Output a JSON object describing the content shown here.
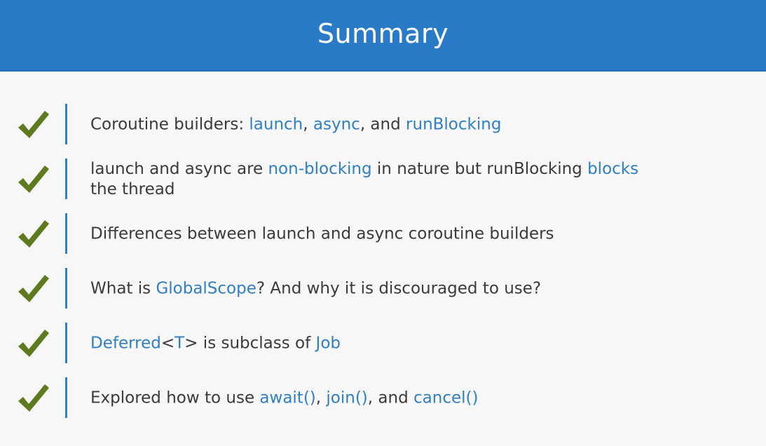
{
  "slide": {
    "title": "Summary"
  },
  "colors": {
    "header_bg": "#2a7bc7",
    "accent": "#2e7fc4",
    "check": "#5e7a1e",
    "text": "#3a3a3a",
    "background": "#f7f7f7"
  },
  "items": [
    {
      "icon": "checkmark-icon",
      "segments": [
        {
          "text": "Coroutine builders: ",
          "hl": false
        },
        {
          "text": "launch",
          "hl": true
        },
        {
          "text": ", ",
          "hl": false
        },
        {
          "text": "async",
          "hl": true
        },
        {
          "text": ", and ",
          "hl": false
        },
        {
          "text": "runBlocking",
          "hl": true
        }
      ]
    },
    {
      "icon": "checkmark-icon",
      "segments": [
        {
          "text": "launch and async are ",
          "hl": false
        },
        {
          "text": "non-blocking",
          "hl": true
        },
        {
          "text": " in nature but runBlocking ",
          "hl": false
        },
        {
          "text": "blocks",
          "hl": true
        },
        {
          "text": "the thread",
          "hl": false,
          "br": true
        }
      ]
    },
    {
      "icon": "checkmark-icon",
      "segments": [
        {
          "text": "Differences between launch and async coroutine builders",
          "hl": false
        }
      ]
    },
    {
      "icon": "checkmark-icon",
      "segments": [
        {
          "text": "What is ",
          "hl": false
        },
        {
          "text": "GlobalScope",
          "hl": true
        },
        {
          "text": "? And why it is discouraged to use?",
          "hl": false
        }
      ]
    },
    {
      "icon": "checkmark-icon",
      "segments": [
        {
          "text": "Deferred",
          "hl": true
        },
        {
          "text": "<",
          "hl": false
        },
        {
          "text": "T",
          "hl": true
        },
        {
          "text": "> is subclass of ",
          "hl": false
        },
        {
          "text": "Job",
          "hl": true
        }
      ]
    },
    {
      "icon": "checkmark-icon",
      "segments": [
        {
          "text": "Explored how to use ",
          "hl": false
        },
        {
          "text": "await()",
          "hl": true
        },
        {
          "text": ", ",
          "hl": false
        },
        {
          "text": "join()",
          "hl": true
        },
        {
          "text": ", and ",
          "hl": false
        },
        {
          "text": "cancel()",
          "hl": true
        }
      ]
    }
  ]
}
